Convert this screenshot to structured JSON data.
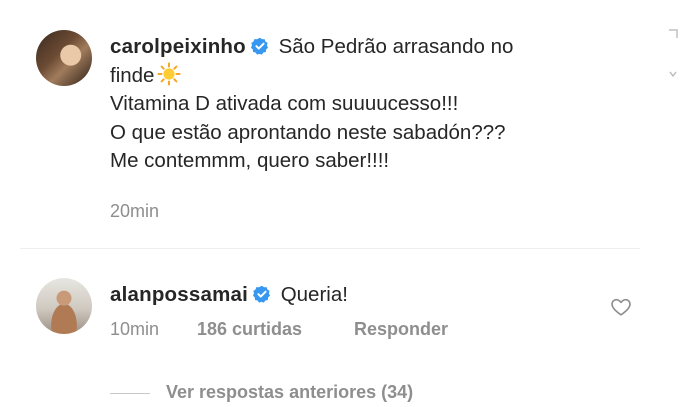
{
  "comment1": {
    "username": "carolpeixinho",
    "line1": "São Pedrão arrasando no",
    "line2": "finde",
    "line3": "Vitamina D ativada com suuuucesso!!!",
    "line4": "O que estão aprontando neste sabadón???",
    "line5": "Me contemmm, quero saber!!!!",
    "time": "20min"
  },
  "comment2": {
    "username": "alanpossamai",
    "text": "Queria!",
    "time": "10min",
    "likes": "186 curtidas",
    "reply": "Responder"
  },
  "replies": {
    "label": "Ver respostas anteriores (34)"
  },
  "colors": {
    "verified": "#3897f0",
    "muted": "#8e8e8e",
    "text": "#262626"
  }
}
